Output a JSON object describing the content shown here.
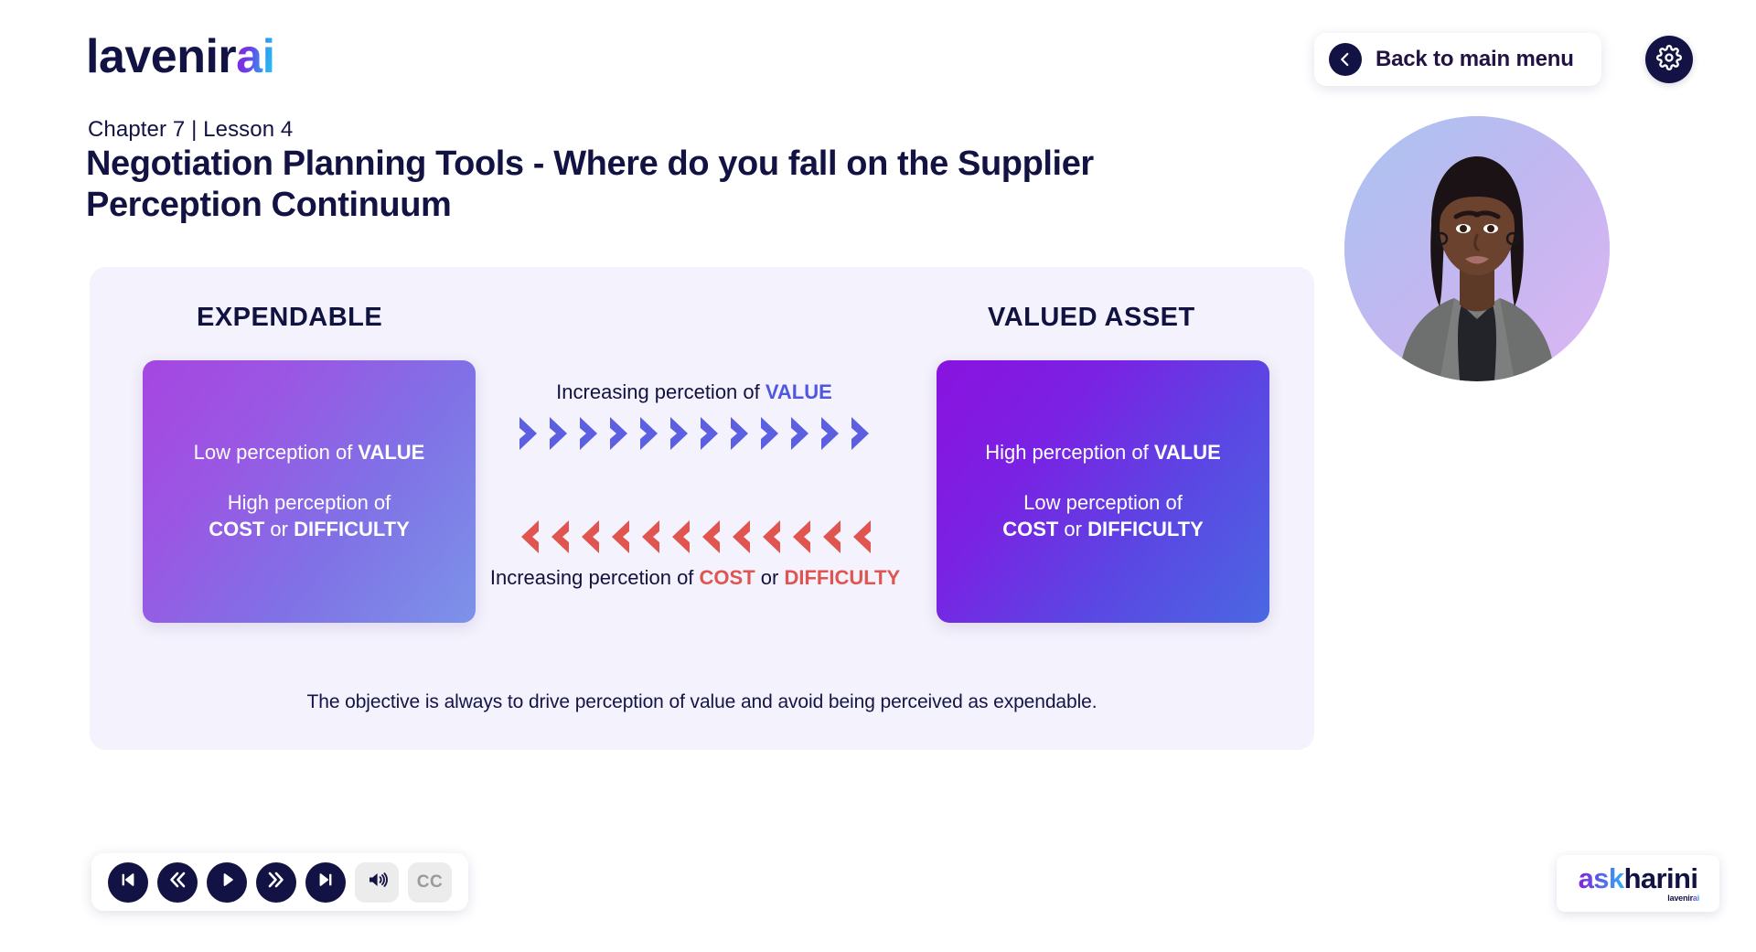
{
  "brand": {
    "logo_dark": "lavenir",
    "logo_accent": "ai"
  },
  "header": {
    "back_button_label": "Back to main menu",
    "back_icon": "chevron-left-circle-icon",
    "settings_icon": "gear-icon"
  },
  "lesson": {
    "chapter_line": "Chapter 7 | Lesson 4",
    "title": "Negotiation Planning Tools - Where do you fall on the Supplier Perception Continuum"
  },
  "avatar": {
    "name": "ai-presenter-avatar",
    "description": "AI presenter avatar on circular gradient background"
  },
  "diagram": {
    "left_heading": "EXPENDABLE",
    "right_heading": "VALUED ASSET",
    "left_card": {
      "line1_prefix": "Low perception of ",
      "line1_bold": "VALUE",
      "line2_prefix": "High perception of",
      "line2_bold_a": "COST",
      "line2_mid": " or ",
      "line2_bold_b": "DIFFICULTY"
    },
    "right_card": {
      "line1_prefix": "High perception of ",
      "line1_bold": "VALUE",
      "line2_prefix": "Low perception of",
      "line2_bold_a": "COST",
      "line2_mid": " or ",
      "line2_bold_b": "DIFFICULTY"
    },
    "value_arrow": {
      "label_prefix": "Increasing percetion of ",
      "label_bold": "VALUE",
      "direction": "right",
      "count": 12,
      "color": "#5b5fe0"
    },
    "cost_arrow": {
      "label_prefix": "Increasing percetion of ",
      "label_bold_a": "COST",
      "label_mid": " or ",
      "label_bold_b": "DIFFICULTY",
      "direction": "left",
      "count": 12,
      "color": "#e0554f"
    },
    "note": "The objective is always to drive perception of value and avoid being perceived as expendable."
  },
  "player": {
    "controls": [
      {
        "name": "skip-to-start-button",
        "icon": "skip-back-icon"
      },
      {
        "name": "rewind-button",
        "icon": "rewind-icon"
      },
      {
        "name": "play-button",
        "icon": "play-icon"
      },
      {
        "name": "fast-forward-button",
        "icon": "fast-forward-icon"
      },
      {
        "name": "skip-to-end-button",
        "icon": "skip-forward-icon"
      }
    ],
    "volume_icon": "volume-icon",
    "captions_label": "CC"
  },
  "product_brand": {
    "name_grad": "ask",
    "name_dark": "harini",
    "sub_dark": "lavenir",
    "sub_grad": "ai"
  },
  "colors": {
    "navy": "#131245",
    "panel_bg": "#f4f2fc",
    "value_accent": "#5b5fe0",
    "cost_accent": "#e0554f",
    "card_left_from": "#a646e2",
    "card_left_to": "#7c93e8",
    "card_right_from": "#8a12e0",
    "card_right_to": "#4a68e2"
  }
}
